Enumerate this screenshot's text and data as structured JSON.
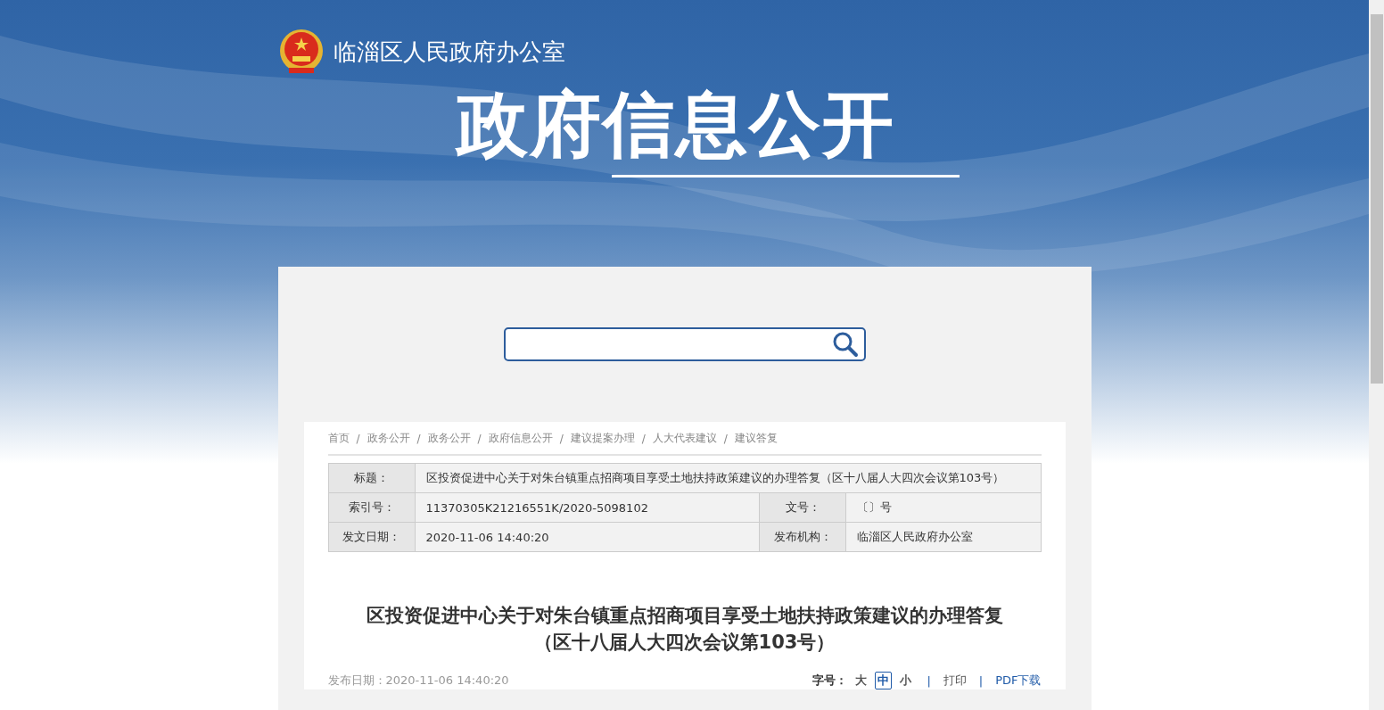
{
  "header": {
    "org_name": "临淄区人民政府办公室",
    "title": "政府信息公开"
  },
  "breadcrumb": {
    "separator": "/",
    "items": [
      "首页",
      "政务公开",
      "政务公开",
      "政府信息公开",
      "建议提案办理",
      "人大代表建议",
      "建议答复"
    ]
  },
  "info_table": {
    "rows": [
      [
        {
          "label": "标题：",
          "value": "区投资促进中心关于对朱台镇重点招商项目享受土地扶持政策建议的办理答复（区十八届人大四次会议第103号）"
        }
      ],
      [
        {
          "label": "索引号：",
          "value": "11370305K21216551K/2020-5098102"
        },
        {
          "label": "文号：",
          "value": "〔〕号"
        }
      ],
      [
        {
          "label": "发文日期：",
          "value": "2020-11-06 14:40:20"
        },
        {
          "label": "发布机构：",
          "value": "临淄区人民政府办公室"
        }
      ]
    ]
  },
  "article": {
    "title_lines": [
      "区投资促进中心关于对朱台镇重点招商项目享受土地扶持政策建议的办理答复",
      "（区十八届人大四次会议第103号）"
    ],
    "publish_date": "发布日期：2020-11-06 14:40:20",
    "font_size": {
      "label": "字号：",
      "options": [
        {
          "label": "大",
          "selected": false
        },
        {
          "label": "中",
          "selected": true
        },
        {
          "label": "小",
          "selected": false
        }
      ]
    },
    "separator": "|",
    "actions": [
      "打印",
      "PDF下载"
    ]
  }
}
